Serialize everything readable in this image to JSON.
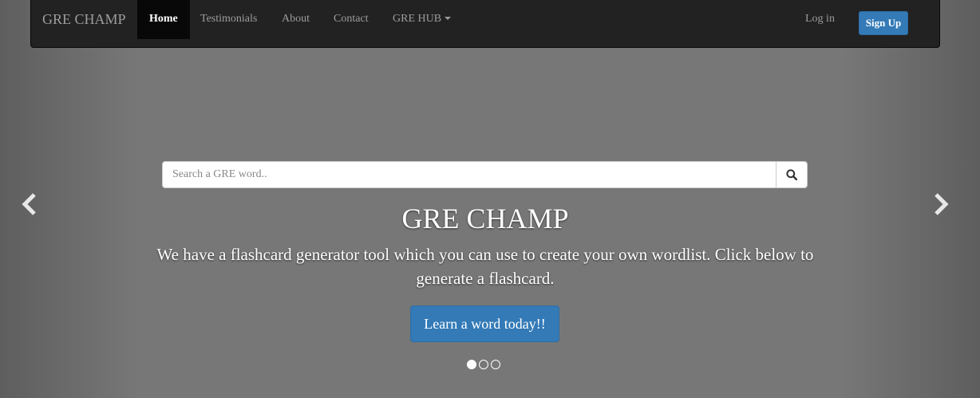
{
  "navbar": {
    "brand": "GRE CHAMP",
    "items": [
      {
        "label": "Home",
        "active": true
      },
      {
        "label": "Testimonials",
        "active": false
      },
      {
        "label": "About",
        "active": false
      },
      {
        "label": "Contact",
        "active": false
      },
      {
        "label": "GRE HUB",
        "active": false,
        "dropdown": true
      }
    ],
    "login_label": "Log in",
    "signup_label": "Sign Up"
  },
  "search": {
    "placeholder": "Search a GRE word..",
    "value": "",
    "icon": "search-icon"
  },
  "carousel": {
    "title": "GRE CHAMP",
    "description": "We have a flashcard generator tool which you can use to create your own wordlist. Click below to generate a flashcard.",
    "cta_label": "Learn a word today!!",
    "slide_count": 3,
    "active_slide": 1,
    "prev_icon": "chevron-left-icon",
    "next_icon": "chevron-right-icon"
  },
  "colors": {
    "navbar_bg": "#222222",
    "primary": "#337ab7",
    "slide_bg": "#777777"
  }
}
